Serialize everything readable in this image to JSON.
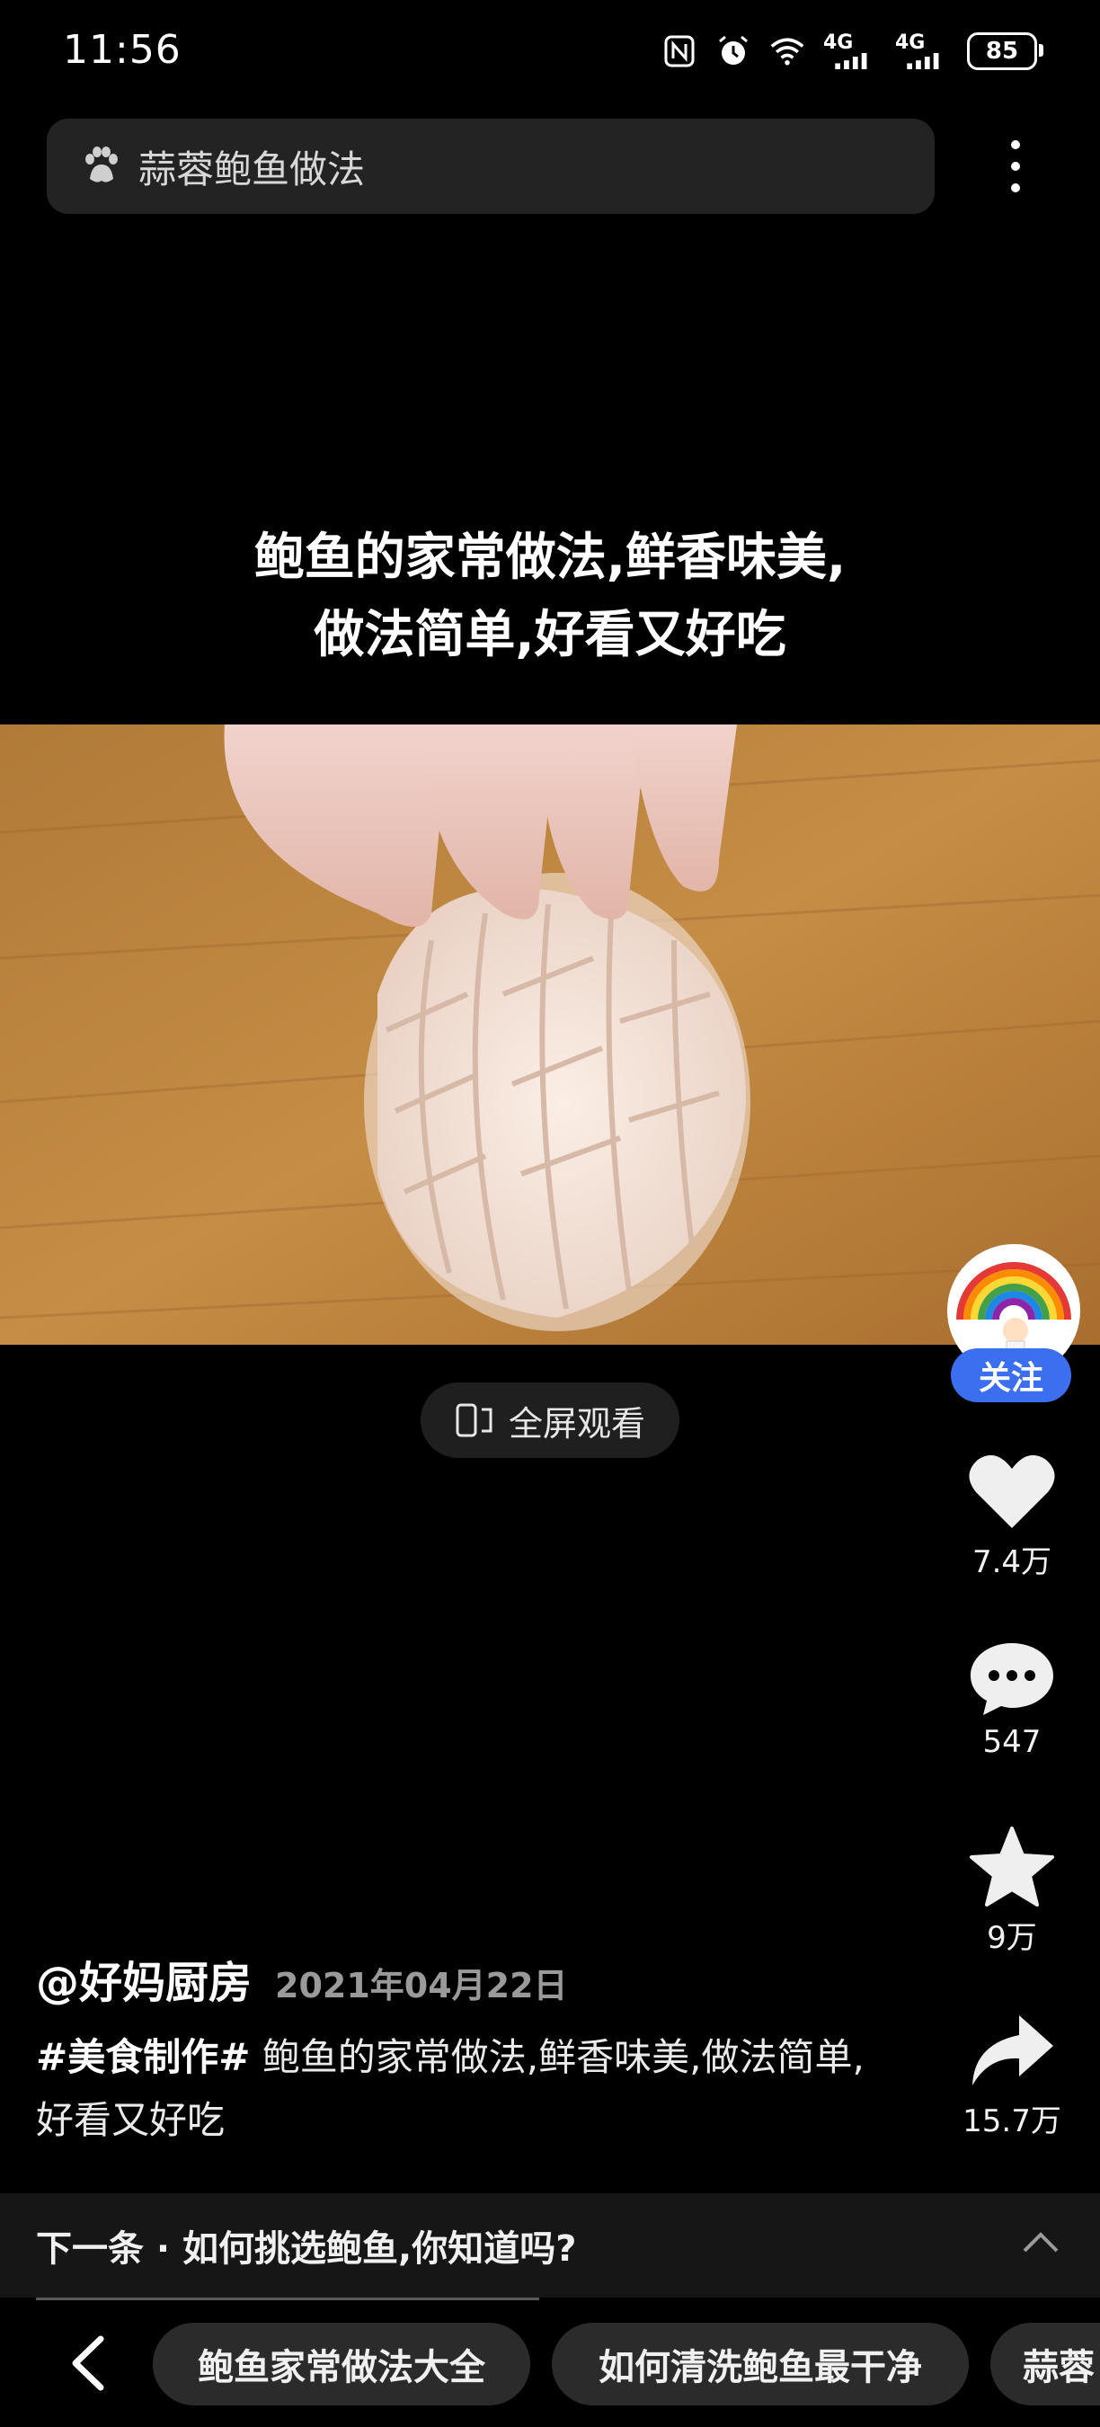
{
  "status_bar": {
    "time": "11:56",
    "net1": "4G",
    "net2": "4G",
    "battery": "85"
  },
  "search": {
    "query": "蒜蓉鲍鱼做法"
  },
  "video": {
    "caption_line1": "鲍鱼的家常做法,鲜香味美,",
    "caption_line2": "做法简单,好看又好吃",
    "fullscreen_label": "全屏观看"
  },
  "rail": {
    "follow_label": "关注",
    "likes": "7.4万",
    "comments": "547",
    "favorites": "9万",
    "shares": "15.7万"
  },
  "post": {
    "author": "@好妈厨房",
    "date": "2021年04月22日",
    "hashtag": "#美食制作#",
    "description": " 鲍鱼的家常做法,鲜香味美,做法简单,好看又好吃"
  },
  "next": {
    "label": "下一条 · 如何挑选鲍鱼,你知道吗?"
  },
  "related": {
    "chips": [
      "鲍鱼家常做法大全",
      "如何清洗鲍鱼最干净",
      "蒜蓉"
    ]
  },
  "colors": {
    "accent": "#3c6ff0",
    "background": "#000000"
  }
}
